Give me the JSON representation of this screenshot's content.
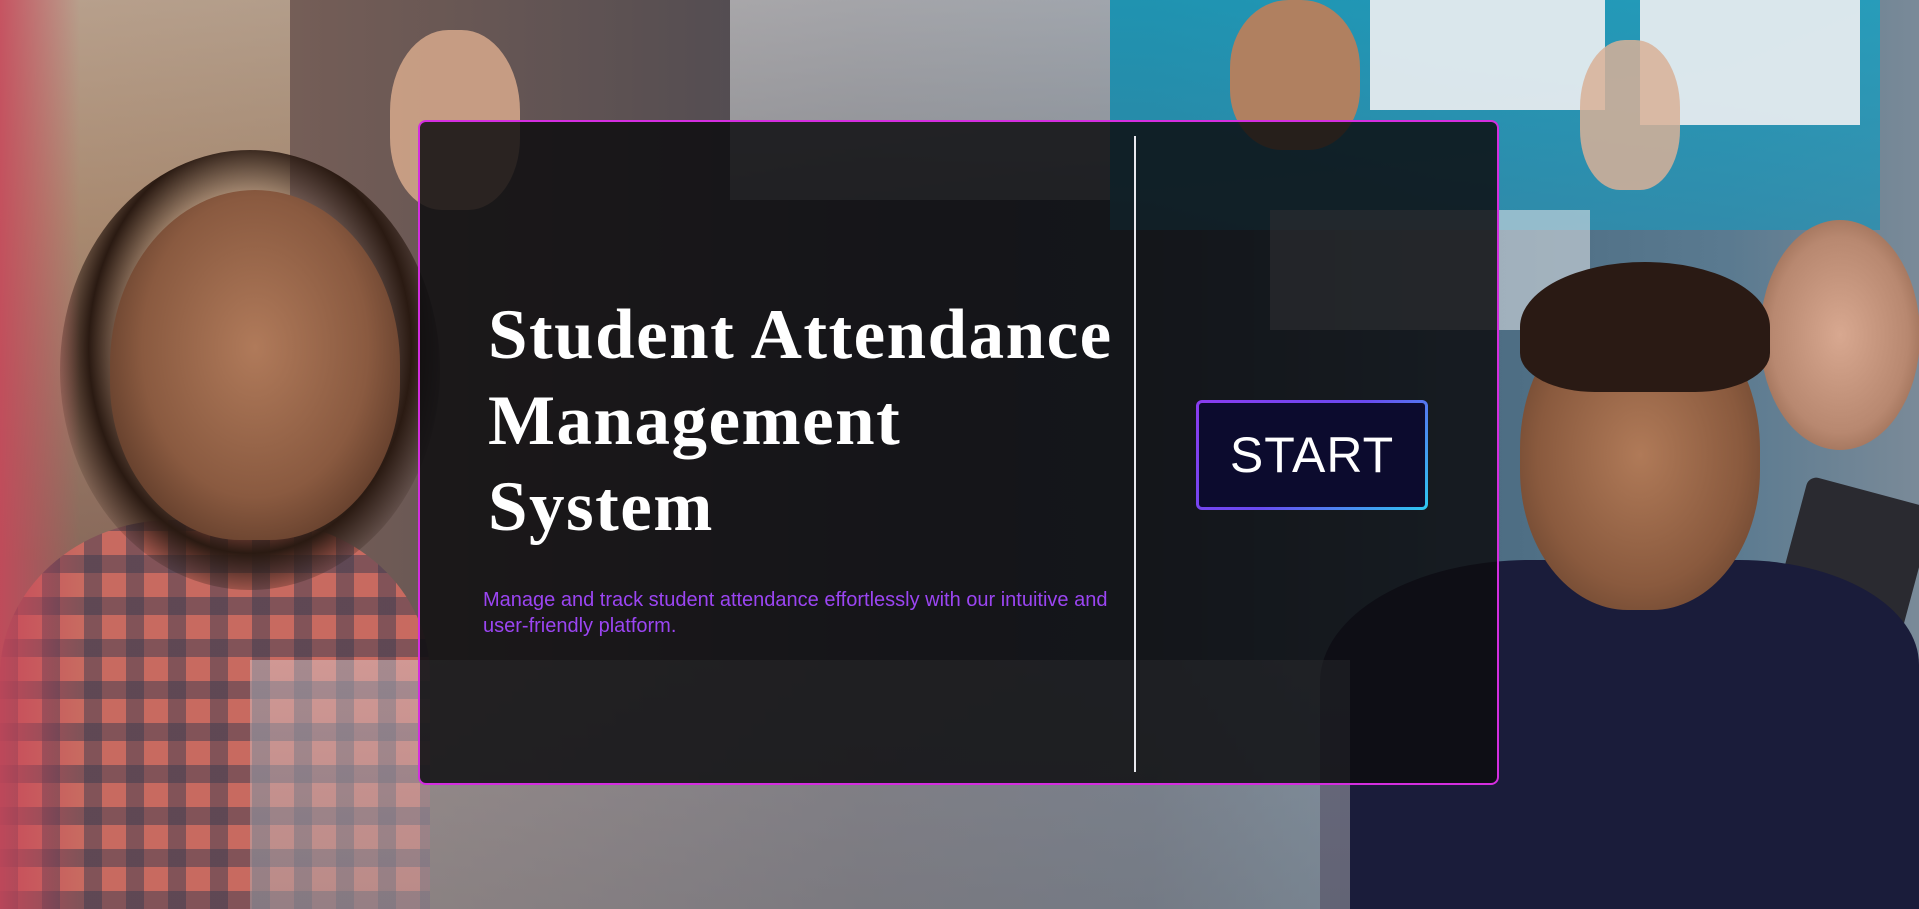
{
  "background": {
    "description_icon": "classroom-photo"
  },
  "hero": {
    "title_lines": [
      "Student Attendance",
      "Management",
      "System"
    ],
    "subtitle": "Manage and track student attendance effortlessly with our intuitive and user-friendly platform."
  },
  "actions": {
    "start_label": "START"
  },
  "colors": {
    "panel_border": "#d42ee0",
    "subtitle": "#9b45f2",
    "button_fill": "#0c0b2e",
    "button_border_start": "#8a3cf0",
    "button_border_end": "#2ec8f0"
  }
}
